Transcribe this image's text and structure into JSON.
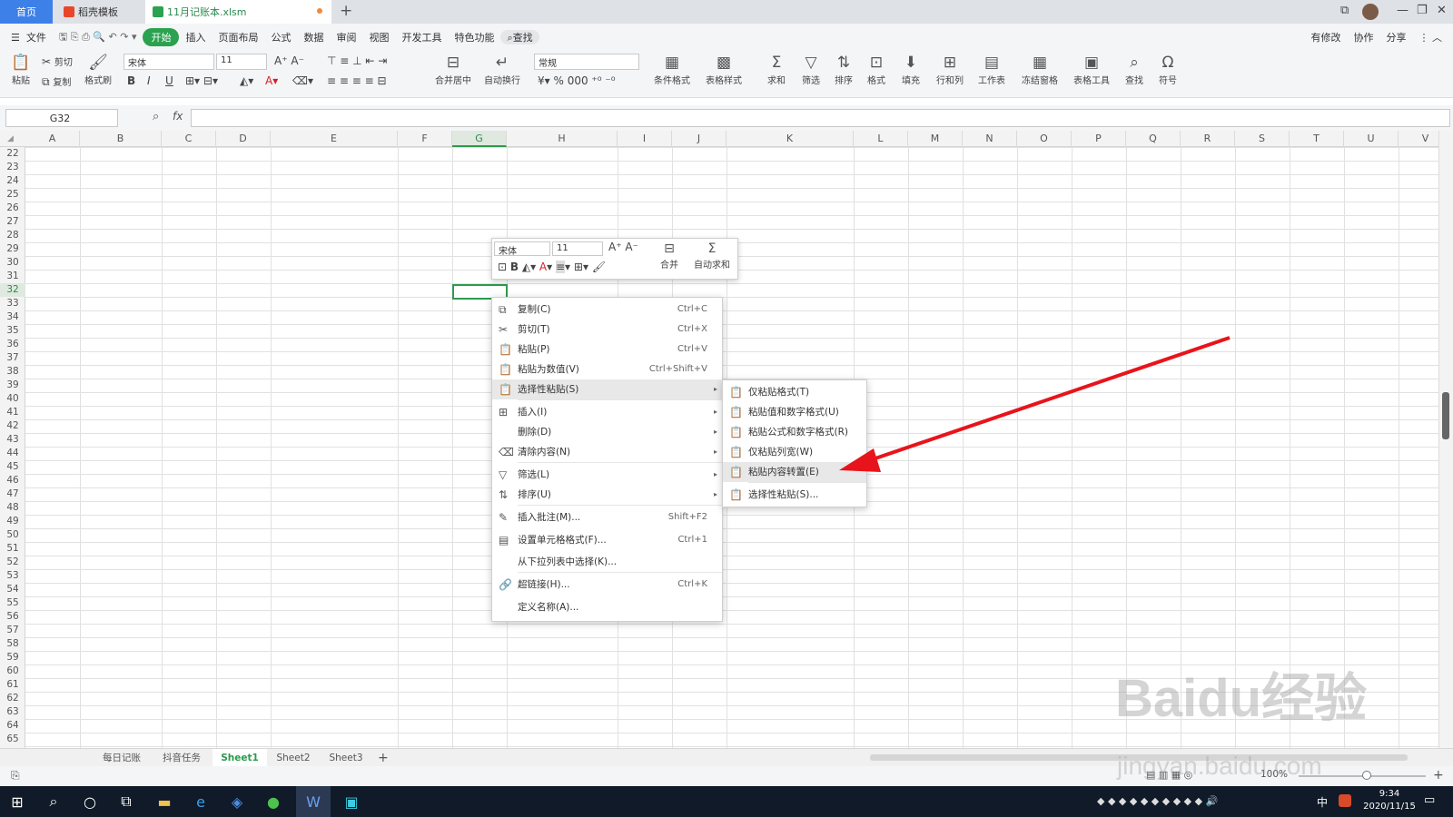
{
  "tabs": {
    "home": "首页",
    "daoke": "稻壳模板",
    "file": "11月记账本.xlsm",
    "new": "+"
  },
  "menu": {
    "file": "文件",
    "start": "开始",
    "items": [
      "插入",
      "页面布局",
      "公式",
      "数据",
      "审阅",
      "视图",
      "开发工具",
      "特色功能"
    ],
    "search": "查找",
    "right": [
      "有修改",
      "协作",
      "分享"
    ]
  },
  "ribbon": {
    "paste": "粘贴",
    "cut": "剪切",
    "copy": "复制",
    "format_painter": "格式刷",
    "font": "宋体",
    "size": "11",
    "merge": "合并居中",
    "wrap": "自动换行",
    "numfmt": "常规",
    "cond": "条件格式",
    "tablestyle": "表格样式",
    "sum": "求和",
    "filter": "筛选",
    "sort": "排序",
    "format": "格式",
    "fill": "填充",
    "rowcol": "行和列",
    "sheet": "工作表",
    "freeze": "冻结窗格",
    "tabletools": "表格工具",
    "find": "查找",
    "symbol": "符号"
  },
  "namebox": "G32",
  "fx": "fx",
  "columns": [
    "A",
    "B",
    "C",
    "D",
    "E",
    "F",
    "G",
    "H",
    "I",
    "J",
    "K",
    "L",
    "M",
    "N",
    "O",
    "P",
    "Q",
    "R",
    "S",
    "T",
    "U",
    "V"
  ],
  "rows": [
    "22",
    "23",
    "24",
    "25",
    "26",
    "27",
    "28",
    "29",
    "30",
    "31",
    "32",
    "33",
    "34",
    "35",
    "36",
    "37",
    "38",
    "39",
    "40",
    "41",
    "42",
    "43",
    "44",
    "45",
    "46",
    "47",
    "48",
    "49",
    "50",
    "51",
    "52",
    "53",
    "54",
    "55",
    "56",
    "57",
    "58",
    "59",
    "60",
    "61",
    "62",
    "63",
    "64",
    "65"
  ],
  "mini": {
    "font": "宋体",
    "size": "11",
    "merge": "合并",
    "autosum": "自动求和"
  },
  "context_menu": [
    {
      "icon": "⧉",
      "label": "复制(C)",
      "shortcut": "Ctrl+C"
    },
    {
      "icon": "✂",
      "label": "剪切(T)",
      "shortcut": "Ctrl+X"
    },
    {
      "icon": "📋",
      "label": "粘贴(P)",
      "shortcut": "Ctrl+V"
    },
    {
      "icon": "📋",
      "label": "粘贴为数值(V)",
      "shortcut": "Ctrl+Shift+V"
    },
    {
      "icon": "📋",
      "label": "选择性粘贴(S)",
      "shortcut": ""
    },
    {
      "icon": "⊞",
      "label": "插入(I)",
      "shortcut": ""
    },
    {
      "icon": "",
      "label": "删除(D)",
      "shortcut": ""
    },
    {
      "icon": "⌫",
      "label": "清除内容(N)",
      "shortcut": ""
    },
    {
      "icon": "▽",
      "label": "筛选(L)",
      "shortcut": ""
    },
    {
      "icon": "⇅",
      "label": "排序(U)",
      "shortcut": ""
    },
    {
      "icon": "✎",
      "label": "插入批注(M)...",
      "shortcut": "Shift+F2"
    },
    {
      "icon": "▤",
      "label": "设置单元格格式(F)...",
      "shortcut": "Ctrl+1"
    },
    {
      "icon": "",
      "label": "从下拉列表中选择(K)...",
      "shortcut": ""
    },
    {
      "icon": "🔗",
      "label": "超链接(H)...",
      "shortcut": "Ctrl+K"
    },
    {
      "icon": "",
      "label": "定义名称(A)...",
      "shortcut": ""
    }
  ],
  "submenu": [
    "仅粘贴格式(T)",
    "粘贴值和数字格式(U)",
    "粘贴公式和数字格式(R)",
    "仅粘贴列宽(W)",
    "粘贴内容转置(E)",
    "选择性粘贴(S)..."
  ],
  "sheets": [
    "每日记账",
    "抖音任务",
    "Sheet1",
    "Sheet2",
    "Sheet3"
  ],
  "status": {
    "zoom": "100%"
  },
  "clock": {
    "time": "9:34",
    "date": "2020/11/15"
  },
  "ime": "中",
  "watermark": {
    "logo": "Baidu经验",
    "url": "jingyan.baidu.com"
  },
  "colors": {
    "accent": "#2aa24f",
    "selection": "#2e9a4e",
    "arrow": "#e8141b"
  }
}
